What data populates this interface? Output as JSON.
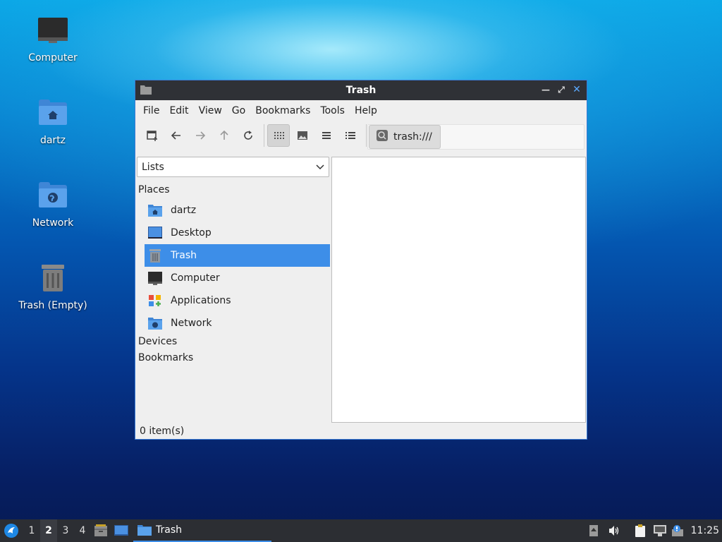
{
  "desktop": {
    "icons": [
      {
        "label": "Computer",
        "icon": "monitor-icon"
      },
      {
        "label": "dartz",
        "icon": "home-folder-icon"
      },
      {
        "label": "Network",
        "icon": "network-folder-icon"
      },
      {
        "label": "Trash (Empty)",
        "icon": "trash-icon"
      }
    ]
  },
  "window": {
    "title": "Trash",
    "controls": [
      "minimize-icon",
      "maximize-icon",
      "close-icon"
    ],
    "menu": [
      "File",
      "Edit",
      "View",
      "Go",
      "Bookmarks",
      "Tools",
      "Help"
    ],
    "toolbar": {
      "buttons": [
        "new-tab-icon",
        "back-icon",
        "forward-icon",
        "up-icon",
        "reload-icon",
        "icon-view-icon",
        "thumbnail-view-icon",
        "compact-view-icon",
        "detailed-list-view-icon"
      ],
      "active_view": "icon-view-icon",
      "location": "trash:///"
    },
    "sidebar": {
      "mode": "Lists",
      "places_header": "Places",
      "places": [
        {
          "label": "dartz",
          "icon": "home-folder-icon"
        },
        {
          "label": "Desktop",
          "icon": "desktop-icon"
        },
        {
          "label": "Trash",
          "icon": "trash-icon",
          "selected": true
        },
        {
          "label": "Computer",
          "icon": "monitor-icon"
        },
        {
          "label": "Applications",
          "icon": "applications-icon"
        },
        {
          "label": "Network",
          "icon": "network-folder-icon"
        }
      ],
      "devices_header": "Devices",
      "bookmarks_header": "Bookmarks"
    },
    "status": "0 item(s)"
  },
  "taskbar": {
    "workspaces": [
      "1",
      "2",
      "3",
      "4"
    ],
    "current_workspace": "2",
    "task_label": "Trash",
    "clock": "11:25"
  },
  "colors": {
    "selection": "#3d8ee8",
    "titlebar": "#2f3136",
    "taskbar": "#2c2e33"
  }
}
